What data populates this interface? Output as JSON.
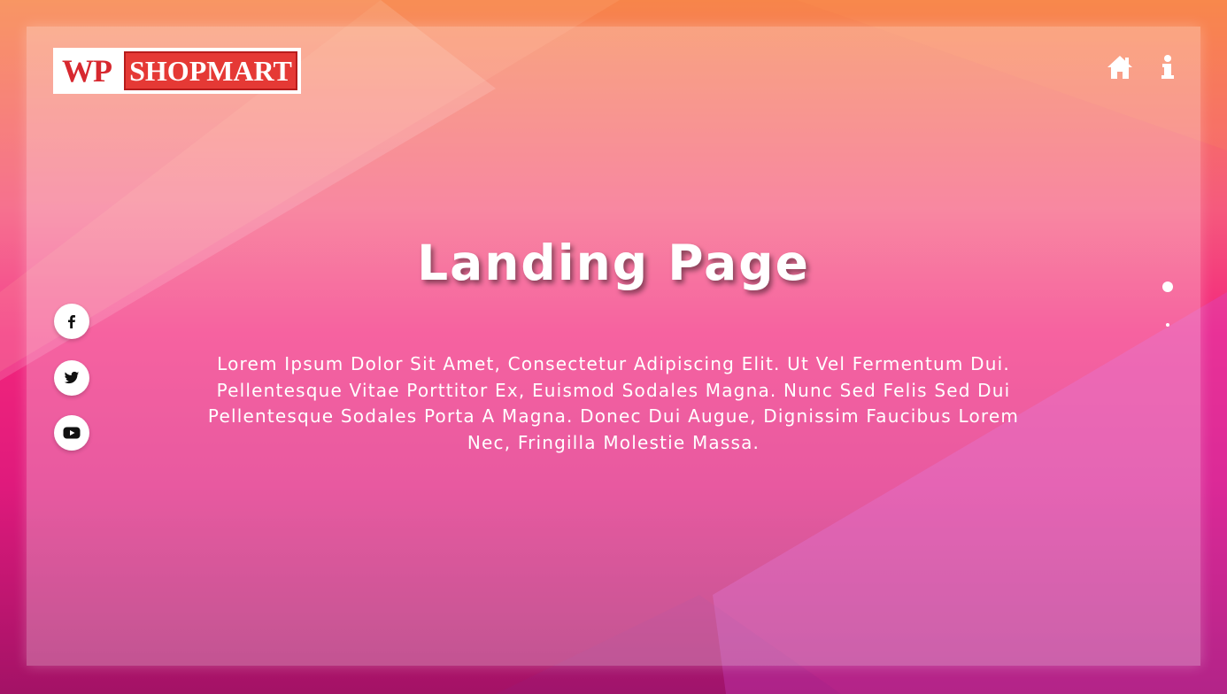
{
  "logo": {
    "prefix": "WP",
    "name": "SHOPMART"
  },
  "nav": {
    "icons": [
      "home-icon",
      "info-icon"
    ]
  },
  "hero": {
    "title": "Landing Page",
    "description": "Lorem Ipsum Dolor Sit Amet, Consectetur Adipiscing Elit. Ut Vel Fermentum Dui. Pellentesque Vitae Porttitor Ex, Euismod Sodales Magna. Nunc Sed Felis Sed Dui Pellentesque Sodales Porta A Magna. Donec Dui Augue, Dignissim Faucibus Lorem Nec, Fringilla Molestie Massa."
  },
  "social": [
    "facebook-icon",
    "twitter-icon",
    "youtube-icon"
  ],
  "slider_dots": {
    "count": 2,
    "active_index": 0
  },
  "colors": {
    "logo_red": "#e53935",
    "gradient_top": "#f7854a",
    "gradient_mid": "#f3267c",
    "gradient_bottom": "#a31266"
  }
}
